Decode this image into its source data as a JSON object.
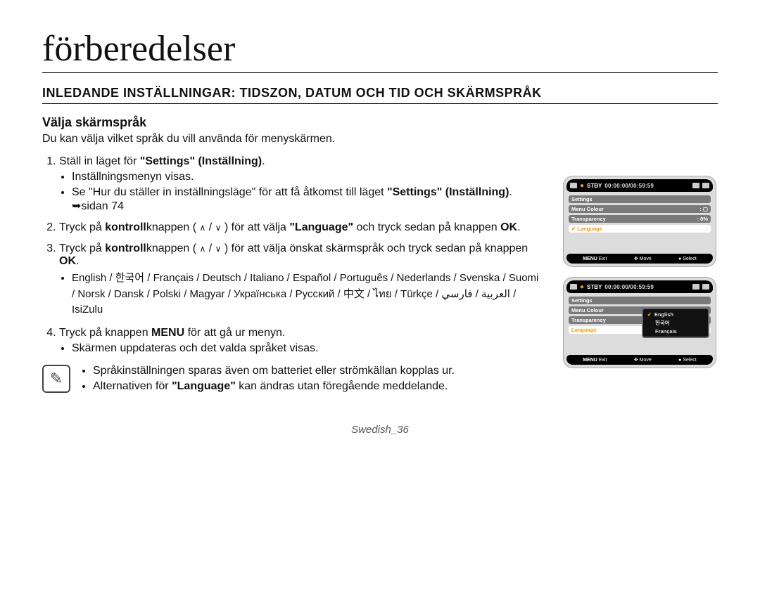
{
  "title": "förberedelser",
  "heading": "INLEDANDE INSTÄLLNINGAR: TIDSZON, DATUM OCH TID OCH SKÄRMSPRÅK",
  "subhead": "Välja skärmspråk",
  "intro": "Du kan välja vilket språk du vill använda för menyskärmen.",
  "steps": {
    "s1a": "Ställ in läget för ",
    "s1a_bold": "\"Settings\" (Inställning)",
    "s1a_end": ".",
    "s1b1": "Inställningsmenyn visas.",
    "s1b2a": "Se \"Hur du ställer in inställningsläge\" för att få åtkomst till läget ",
    "s1b2_bold": "\"Settings\" (Inställning)",
    "s1b2b": ". ➥sidan 74",
    "s2a": "Tryck på ",
    "s2_bold1": "kontroll",
    "s2b": "knappen ( ",
    "s2c": " / ",
    "s2d": " ) för att välja ",
    "s2_bold2": "\"Language\"",
    "s2e": " och tryck sedan på knappen ",
    "s2_bold3": "OK",
    "s2f": ".",
    "s3a": "Tryck på ",
    "s3_bold1": "kontroll",
    "s3b": "knappen ( ",
    "s3c": " / ",
    "s3d": " ) för att välja önskat skärmspråk och tryck sedan på knappen ",
    "s3_bold2": "OK",
    "s3e": ".",
    "s3_langs": "English / 한국어 / Français / Deutsch / Italiano / Español / Português / Nederlands / Svenska / Suomi / Norsk / Dansk / Polski / Magyar / Українська / Русский / 中文 / ไทย / Türkçe / العربية / فارسي / IsiZulu",
    "s4a": "Tryck på knappen ",
    "s4_bold": "MENU",
    "s4b": " för att gå ur menyn.",
    "s4c": "Skärmen uppdateras och det valda språket visas."
  },
  "note1": "Språkinställningen sparas även om batteriet eller strömkällan kopplas ur.",
  "note2a": "Alternativen för ",
  "note2_bold": "\"Language\"",
  "note2b": " kan ändras utan föregående meddelande.",
  "footer": "Swedish_36",
  "screen": {
    "stby": "STBY",
    "timecode": "00:00:00/00:59:59",
    "menu_settings": "Settings",
    "menu_colour": "Menu Colour",
    "menu_transparency": "Transparency",
    "menu_transparency_val": "0%",
    "menu_language": "Language",
    "bot_menu": "MENU",
    "bot_exit": "Exit",
    "bot_move": "Move",
    "bot_select": "Select",
    "popup_english": "English",
    "popup_korean": "한국어",
    "popup_francais": "Français"
  },
  "icons": {
    "up": "∧",
    "down": "∨",
    "note": "✎"
  }
}
